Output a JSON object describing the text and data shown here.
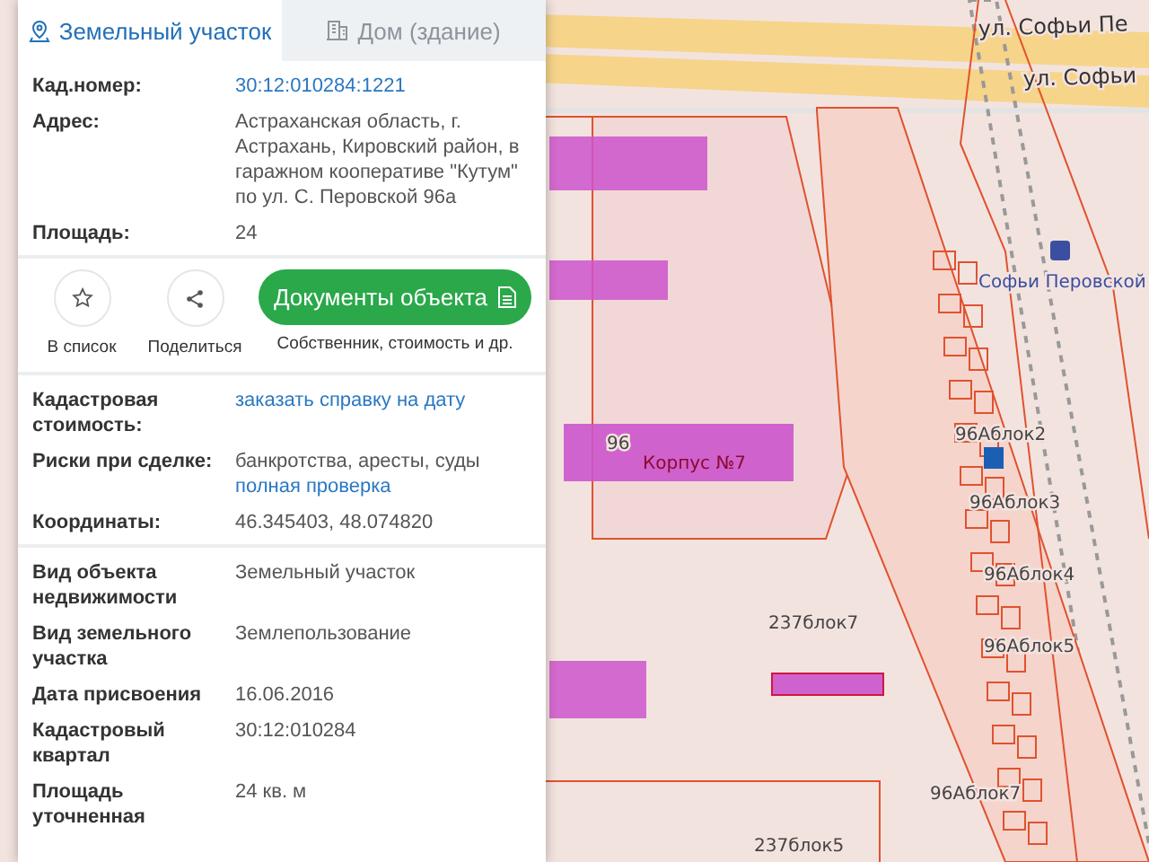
{
  "tabs": [
    {
      "label": "Земельный участок",
      "kind": "parcel",
      "selected": true
    },
    {
      "label": "Дом (здание)",
      "kind": "building",
      "selected": false
    }
  ],
  "info_rows": [
    {
      "label": "Кад.номер:",
      "values": [
        {
          "text": "30:12:010284:1221",
          "link": true
        }
      ]
    },
    {
      "label": "Адрес:",
      "values": [
        {
          "text": "Астраханская область, г. Астрахань, Кировский район, в гаражном кооперативе \"Кутум\" по ул. С. Перовской 96а",
          "link": false
        }
      ]
    },
    {
      "label": "Площадь:",
      "values": [
        {
          "text": "24",
          "link": false
        }
      ]
    }
  ],
  "actions": [
    {
      "label": "В список",
      "kind": "star"
    },
    {
      "label": "Поделиться",
      "kind": "share"
    }
  ],
  "documents_button": {
    "label": "Документы объекта",
    "caption": "Собственник, стоимость и др."
  },
  "detail_rows": [
    {
      "label": "Кадастровая стоимость:",
      "values": [
        {
          "text": "заказать справку на дату",
          "link": true
        }
      ]
    },
    {
      "label": "Риски при сделке:",
      "values": [
        {
          "text": "банкротства, аресты, суды",
          "link": false
        },
        {
          "text": "полная проверка",
          "link": true
        }
      ]
    },
    {
      "label": "Координаты:",
      "values": [
        {
          "text": "46.345403, 48.074820",
          "link": false
        }
      ]
    }
  ],
  "property_rows": [
    {
      "label": "Вид объекта недвижимости",
      "values": [
        {
          "text": "Земельный участок",
          "link": false
        }
      ]
    },
    {
      "label": "Вид земельного участка",
      "values": [
        {
          "text": "Землепользование",
          "link": false
        }
      ]
    },
    {
      "label": "Дата присвоения",
      "values": [
        {
          "text": "16.06.2016",
          "link": false
        }
      ]
    },
    {
      "label": "Кадастровый квартал",
      "values": [
        {
          "text": "30:12:010284",
          "link": false
        }
      ]
    },
    {
      "label": "Площадь уточненная",
      "values": [
        {
          "text": "24 кв. м",
          "link": false
        }
      ]
    }
  ],
  "map": {
    "labels": [
      {
        "text": "ул. Софьи Пе",
        "kind": "street"
      },
      {
        "text": "ул. Софьи",
        "kind": "street"
      },
      {
        "text": "Софьи Перовской",
        "kind": "stop"
      },
      {
        "text": "96Аблок2",
        "kind": "block"
      },
      {
        "text": "96Аблок3",
        "kind": "block"
      },
      {
        "text": "96Аблок4",
        "kind": "block"
      },
      {
        "text": "96Аблок5",
        "kind": "block"
      },
      {
        "text": "96Аблок7",
        "kind": "block"
      },
      {
        "text": "237блок7",
        "kind": "block"
      },
      {
        "text": "237блок5",
        "kind": "block"
      },
      {
        "text": "96",
        "kind": "block"
      },
      {
        "text": "Корпус №7",
        "kind": "poi"
      }
    ]
  }
}
